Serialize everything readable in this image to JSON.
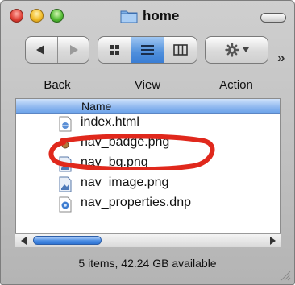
{
  "window": {
    "title": "home"
  },
  "toolbar": {
    "back_label": "Back",
    "view_label": "View",
    "action_label": "Action",
    "overflow": "»"
  },
  "list": {
    "header": "Name",
    "files": [
      {
        "name": "index.html",
        "icon": "html-file-icon"
      },
      {
        "name": "nav_badge.png",
        "icon": "png-file-icon"
      },
      {
        "name": "nav_bg.png",
        "icon": "png-file-icon"
      },
      {
        "name": "nav_image.png",
        "icon": "png-file-icon"
      },
      {
        "name": "nav_properties.dnp",
        "icon": "dnp-file-icon"
      }
    ]
  },
  "status": {
    "text": "5 items, 42.24 GB available"
  },
  "colors": {
    "selection_blue": "#4f8fdc",
    "annotation_red": "#e0281c"
  }
}
